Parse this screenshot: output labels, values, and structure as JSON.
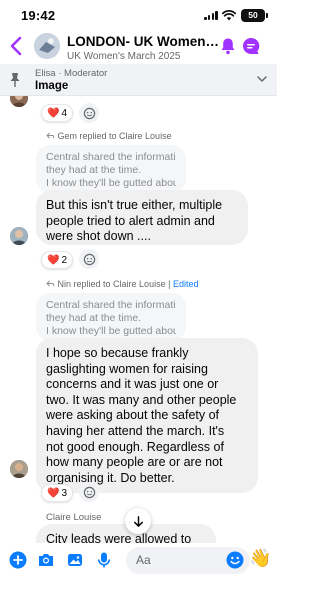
{
  "status_bar": {
    "time": "19:42",
    "battery": "50"
  },
  "header": {
    "title": "LONDON- UK Women's M...",
    "subtitle": "UK Women's March 2025"
  },
  "pinned": {
    "author": "Elisa · Moderator",
    "text": "Image"
  },
  "messages": [
    {
      "reactions": {
        "emoji": "❤️",
        "count": "4"
      }
    },
    {
      "reply_label": "Gem replied to Claire Louise",
      "quote": [
        "Central shared the information",
        "they had at the time.",
        "I know they'll be gutted abou..."
      ],
      "body": [
        "But this isn't true either, multiple",
        "people tried to alert admin and",
        "were shot down ...."
      ],
      "reactions": {
        "emoji": "❤️",
        "count": "2"
      }
    },
    {
      "reply_label": "Nin replied to Claire Louise",
      "edited": "Edited",
      "quote": [
        "Central shared the information",
        "they had at the time.",
        "I know they'll be gutted abou..."
      ],
      "body": [
        "I hope so because frankly",
        "gaslighting women for raising",
        "concerns and it was just one or",
        "two. It was many and other people",
        "were asking about the safety of",
        "having her attend the march. It's",
        "not good enough. Regardless of",
        "how many people are or are not",
        "organising it. Do better."
      ],
      "reactions": {
        "emoji": "❤️",
        "count": "3"
      }
    },
    {
      "sender": "Claire Louise",
      "body": [
        "City leads were allowed to"
      ]
    }
  ],
  "composer": {
    "placeholder": "Aa"
  },
  "colors": {
    "accent": "#a033ff",
    "bubble": "#f0f0f0",
    "quote": "#f5f6f7",
    "link": "#0a7cff",
    "composer_icons": "#0a7cff"
  },
  "icons": [
    "back-chevron-icon",
    "bell-icon",
    "chat-bubble-icon",
    "pin-icon",
    "chevron-down-icon",
    "add-reaction-icon",
    "reply-arrow-icon",
    "arrow-down-icon",
    "plus-icon",
    "camera-icon",
    "photo-icon",
    "microphone-icon",
    "emoji-icon",
    "waving-hand-icon"
  ]
}
